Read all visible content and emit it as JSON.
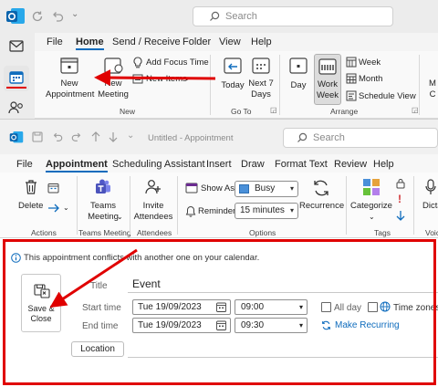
{
  "outer": {
    "search_placeholder": "Search",
    "tabs": [
      "File",
      "Home",
      "Send / Receive",
      "Folder",
      "View",
      "Help"
    ],
    "active_tab": "Home",
    "new_group": {
      "new_appointment": "New Appointment",
      "new_meeting": "New Meeting",
      "add_focus_time": "Add Focus Time",
      "new_items": "New Items",
      "label": "New"
    },
    "goto_group": {
      "today": "Today",
      "next7": "Next 7 Days",
      "label": "Go To"
    },
    "arrange_group": {
      "day": "Day",
      "work_week": "Work Week",
      "week": "Week",
      "month": "Month",
      "schedule_view": "Schedule View",
      "label": "Arrange",
      "partial": "M C"
    }
  },
  "inner": {
    "title": "Untitled - Appointment",
    "search_placeholder": "Search",
    "tabs": [
      "File",
      "Appointment",
      "Scheduling Assistant",
      "Insert",
      "Draw",
      "Format Text",
      "Review",
      "Help"
    ],
    "active_tab": "Appointment",
    "ribbon": {
      "delete": "Delete",
      "actions_label": "Actions",
      "teams_meeting": "Teams Meeting",
      "teams_group_label": "Teams Meeting",
      "invite_attendees": "Invite Attendees",
      "attendees_label": "Attendees",
      "show_as_label": "Show As:",
      "show_as_value": "Busy",
      "reminder_label": "Reminder:",
      "reminder_value": "15 minutes",
      "recurrence": "Recurrence",
      "options_label": "Options",
      "categorize": "Categorize",
      "tags_label": "Tags",
      "dictate_partial": "Dicta",
      "voice_partial": "Voic"
    },
    "form": {
      "conflict_message": "This appointment conflicts with another one on your calendar.",
      "save_close": "Save & Close",
      "title_label": "Title",
      "title_value": "Event",
      "start_label": "Start time",
      "start_date": "Tue 19/09/2023",
      "start_time": "09:00",
      "end_label": "End time",
      "end_date": "Tue 19/09/2023",
      "end_time": "09:30",
      "all_day": "All day",
      "time_zones": "Time zones",
      "make_recurring": "Make Recurring",
      "location": "Location"
    }
  },
  "colors": {
    "accent": "#0f6cbd",
    "annotation_red": "#e00000",
    "busy_swatch": "#4a90d9"
  }
}
